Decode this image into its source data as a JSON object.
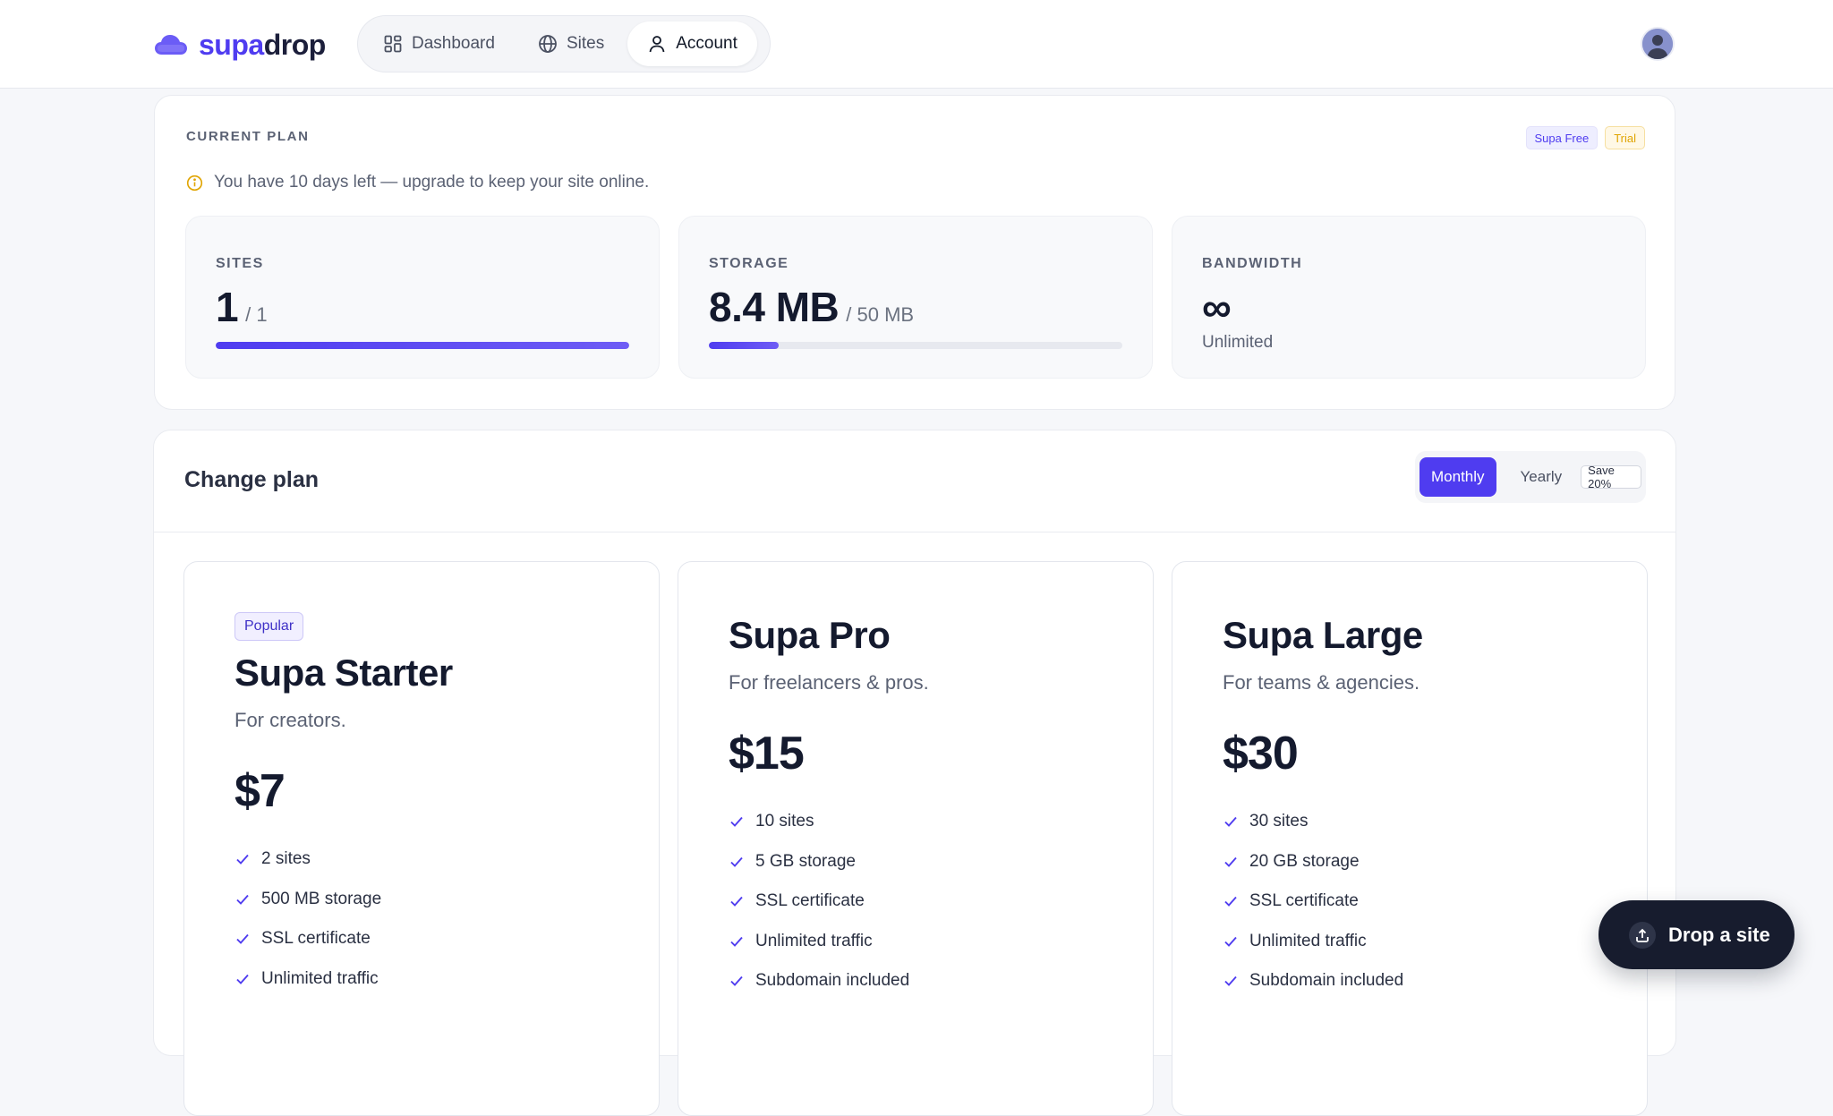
{
  "brand": {
    "part1": "supa",
    "part2": "drop",
    "color": "#4f3cf0"
  },
  "nav": [
    {
      "label": "Dashboard",
      "icon": "grid-icon",
      "active": false
    },
    {
      "label": "Sites",
      "icon": "globe-icon",
      "active": false
    },
    {
      "label": "Account",
      "icon": "user-icon",
      "active": true
    }
  ],
  "current_plan": {
    "section_label": "CURRENT PLAN",
    "plan_badge": "Supa Free",
    "status_badge": "Trial",
    "notice": "You have 10 days left — upgrade to keep your site online.",
    "stats": [
      {
        "label": "SITES",
        "value": "1",
        "limit": "/ 1",
        "progress": 1.0
      },
      {
        "label": "STORAGE",
        "value": "8.4 MB",
        "limit": "/ 50 MB",
        "progress": 0.168
      },
      {
        "label": "BANDWIDTH",
        "value": "∞",
        "sub": "Unlimited"
      }
    ]
  },
  "change_plan": {
    "title": "Change plan",
    "billing": {
      "monthly": "Monthly",
      "yearly": "Yearly",
      "save": "Save 20%",
      "selected": "monthly"
    },
    "tiers": [
      {
        "badge": "Popular",
        "name": "Supa Starter",
        "desc": "For creators.",
        "price": "$7",
        "features": [
          "2 sites",
          "500 MB storage",
          "SSL certificate",
          "Unlimited traffic"
        ]
      },
      {
        "name": "Supa Pro",
        "desc": "For freelancers & pros.",
        "price": "$15",
        "features": [
          "10 sites",
          "5 GB storage",
          "SSL certificate",
          "Unlimited traffic",
          "Subdomain included"
        ]
      },
      {
        "name": "Supa Large",
        "desc": "For teams & agencies.",
        "price": "$30",
        "features": [
          "30 sites",
          "20 GB storage",
          "SSL certificate",
          "Unlimited traffic",
          "Subdomain included"
        ]
      }
    ]
  },
  "fab": {
    "label": "Drop a site",
    "icon": "upload-icon"
  }
}
